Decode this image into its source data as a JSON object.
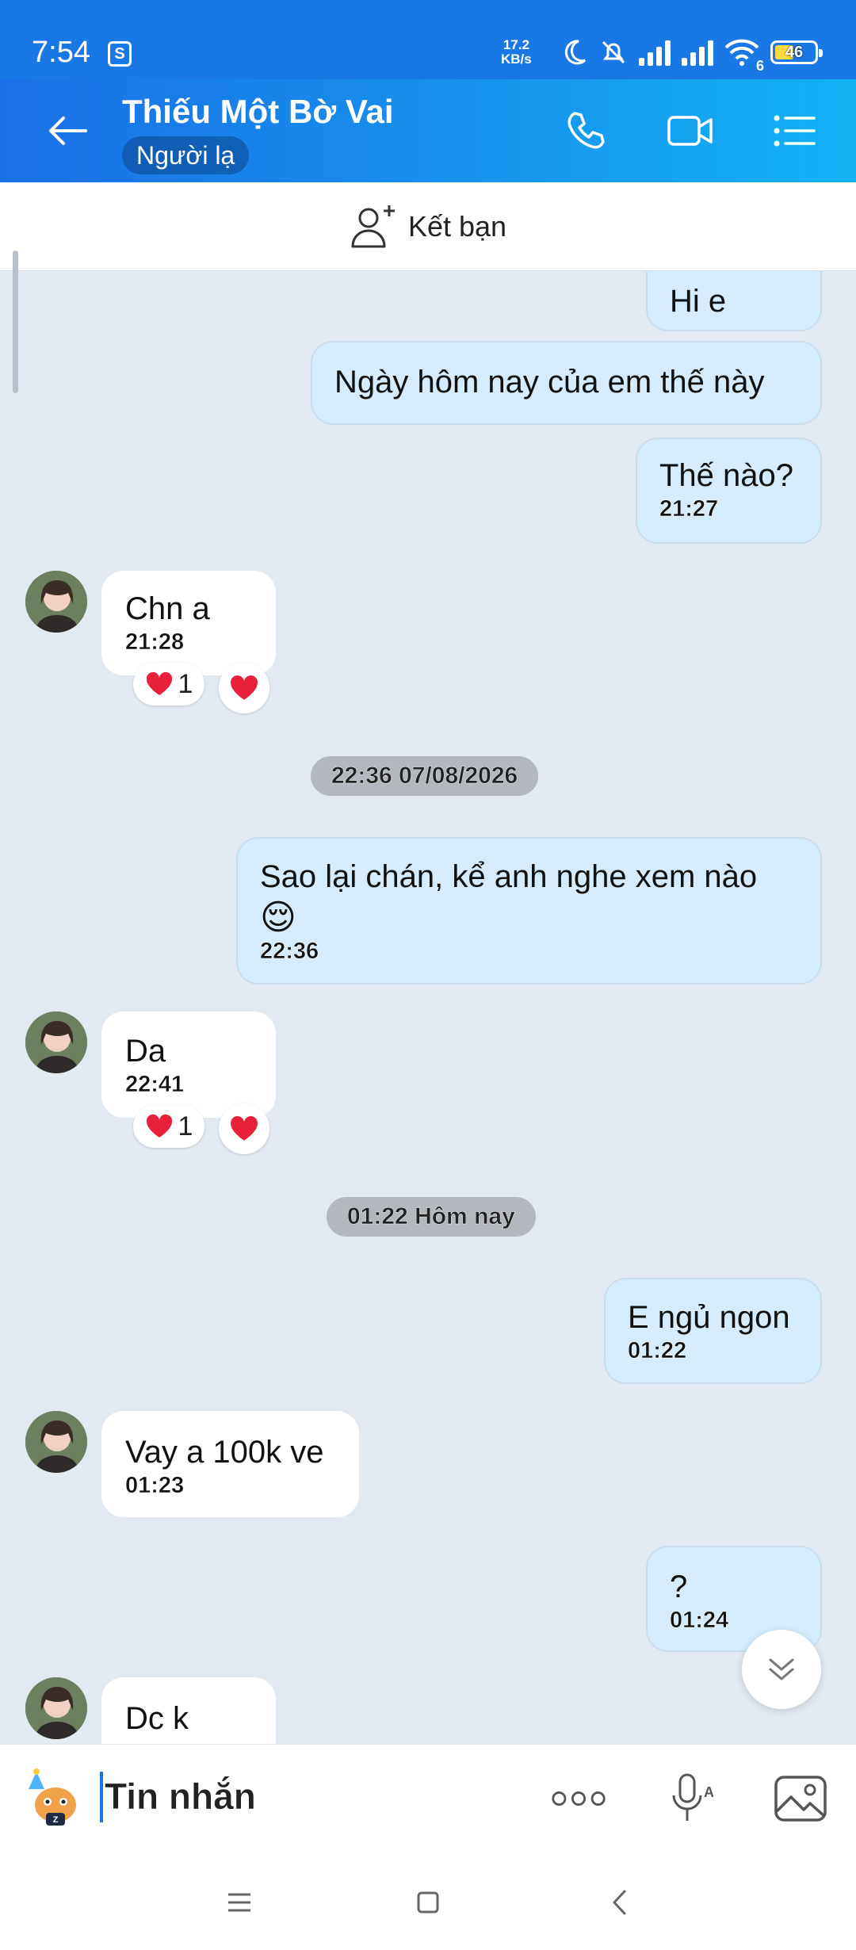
{
  "status_bar": {
    "time": "7:54",
    "net_speed_value": "17.2",
    "net_speed_unit": "KB/s",
    "wifi_label": "6",
    "battery": "46",
    "icons": [
      "shopee-icon",
      "moon-icon",
      "mute-icon",
      "signal-icon",
      "signal-icon",
      "wifi-icon",
      "battery-icon"
    ]
  },
  "header": {
    "title": "Thiếu Một Bờ Vai",
    "subtitle": "Người lạ",
    "icons": [
      "back-arrow-icon",
      "phone-icon",
      "video-icon",
      "list-icon"
    ]
  },
  "friend_bar": {
    "label": "Kết bạn"
  },
  "messages": [
    {
      "dir": "out",
      "text": "Hi e"
    },
    {
      "dir": "out",
      "text": "Ngày hôm nay của em thế này"
    },
    {
      "dir": "out",
      "text": "Thế nào?",
      "time": "21:27"
    },
    {
      "dir": "in",
      "text": "Chn a",
      "time": "21:28",
      "reaction_count": "1"
    },
    {
      "dir": "divider",
      "text": "22:36 07/08/2026"
    },
    {
      "dir": "out",
      "text": "Sao lại chán, kể anh nghe xem nào",
      "emoji": "😌",
      "time": "22:36"
    },
    {
      "dir": "in",
      "text": "Da",
      "time": "22:41",
      "reaction_count": "1"
    },
    {
      "dir": "divider",
      "text": "01:22 Hôm nay"
    },
    {
      "dir": "out",
      "text": "E ngủ ngon",
      "time": "01:22"
    },
    {
      "dir": "in",
      "text": "Vay a 100k ve",
      "time": "01:23"
    },
    {
      "dir": "out",
      "text": "?",
      "time": "01:24"
    },
    {
      "dir": "in",
      "text": "Dc k"
    }
  ],
  "composer": {
    "placeholder": "Tin nhắn",
    "icons": [
      "sticker-icon",
      "more-icon",
      "voice-icon",
      "image-icon"
    ]
  },
  "colors": {
    "header_start": "#1a6fe6",
    "header_end": "#12b2f4",
    "outgoing_bubble": "#d4ecfd",
    "incoming_bubble": "#ffffff",
    "chat_background": "#e2e9f1",
    "reaction_heart": "#e8203a"
  }
}
